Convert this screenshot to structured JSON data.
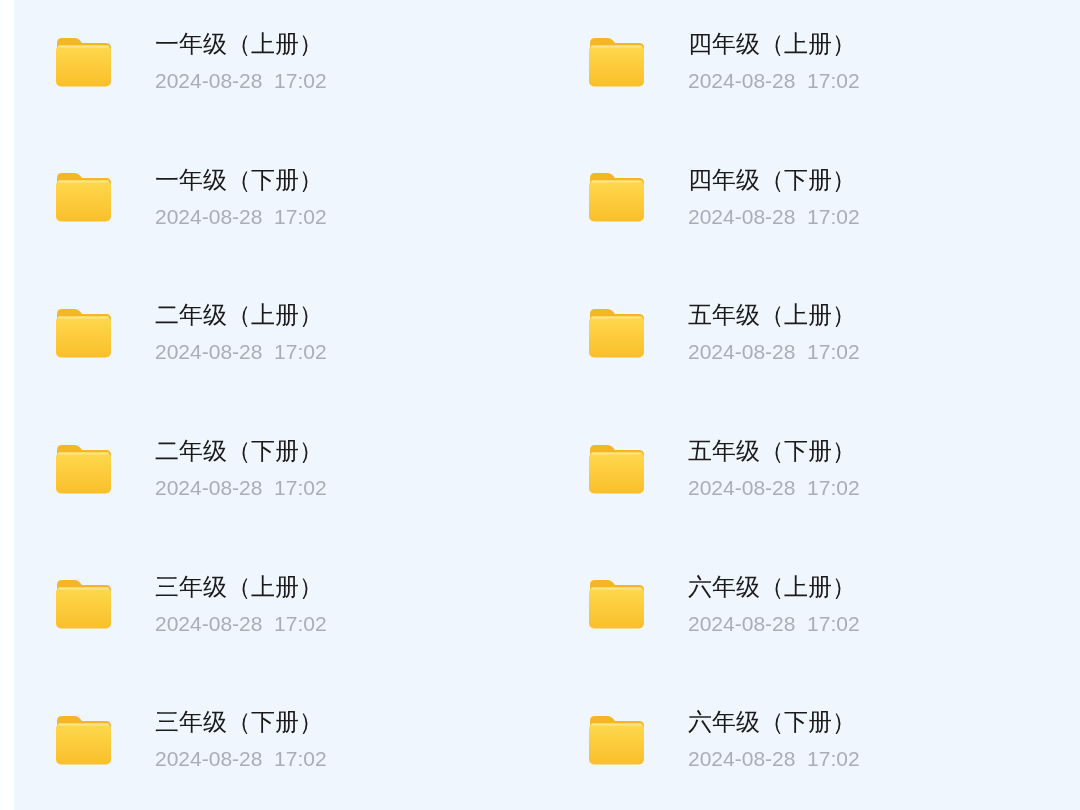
{
  "folders": [
    {
      "name": "一年级（上册）",
      "modified": "2024-08-28  17:02"
    },
    {
      "name": "四年级（上册）",
      "modified": "2024-08-28  17:02"
    },
    {
      "name": "一年级（下册）",
      "modified": "2024-08-28  17:02"
    },
    {
      "name": "四年级（下册）",
      "modified": "2024-08-28  17:02"
    },
    {
      "name": "二年级（上册）",
      "modified": "2024-08-28  17:02"
    },
    {
      "name": "五年级（上册）",
      "modified": "2024-08-28  17:02"
    },
    {
      "name": "二年级（下册）",
      "modified": "2024-08-28  17:02"
    },
    {
      "name": "五年级（下册）",
      "modified": "2024-08-28  17:02"
    },
    {
      "name": "三年级（上册）",
      "modified": "2024-08-28  17:02"
    },
    {
      "name": "六年级（上册）",
      "modified": "2024-08-28  17:02"
    },
    {
      "name": "三年级（下册）",
      "modified": "2024-08-28  17:02"
    },
    {
      "name": "六年级（下册）",
      "modified": "2024-08-28  17:02"
    }
  ]
}
